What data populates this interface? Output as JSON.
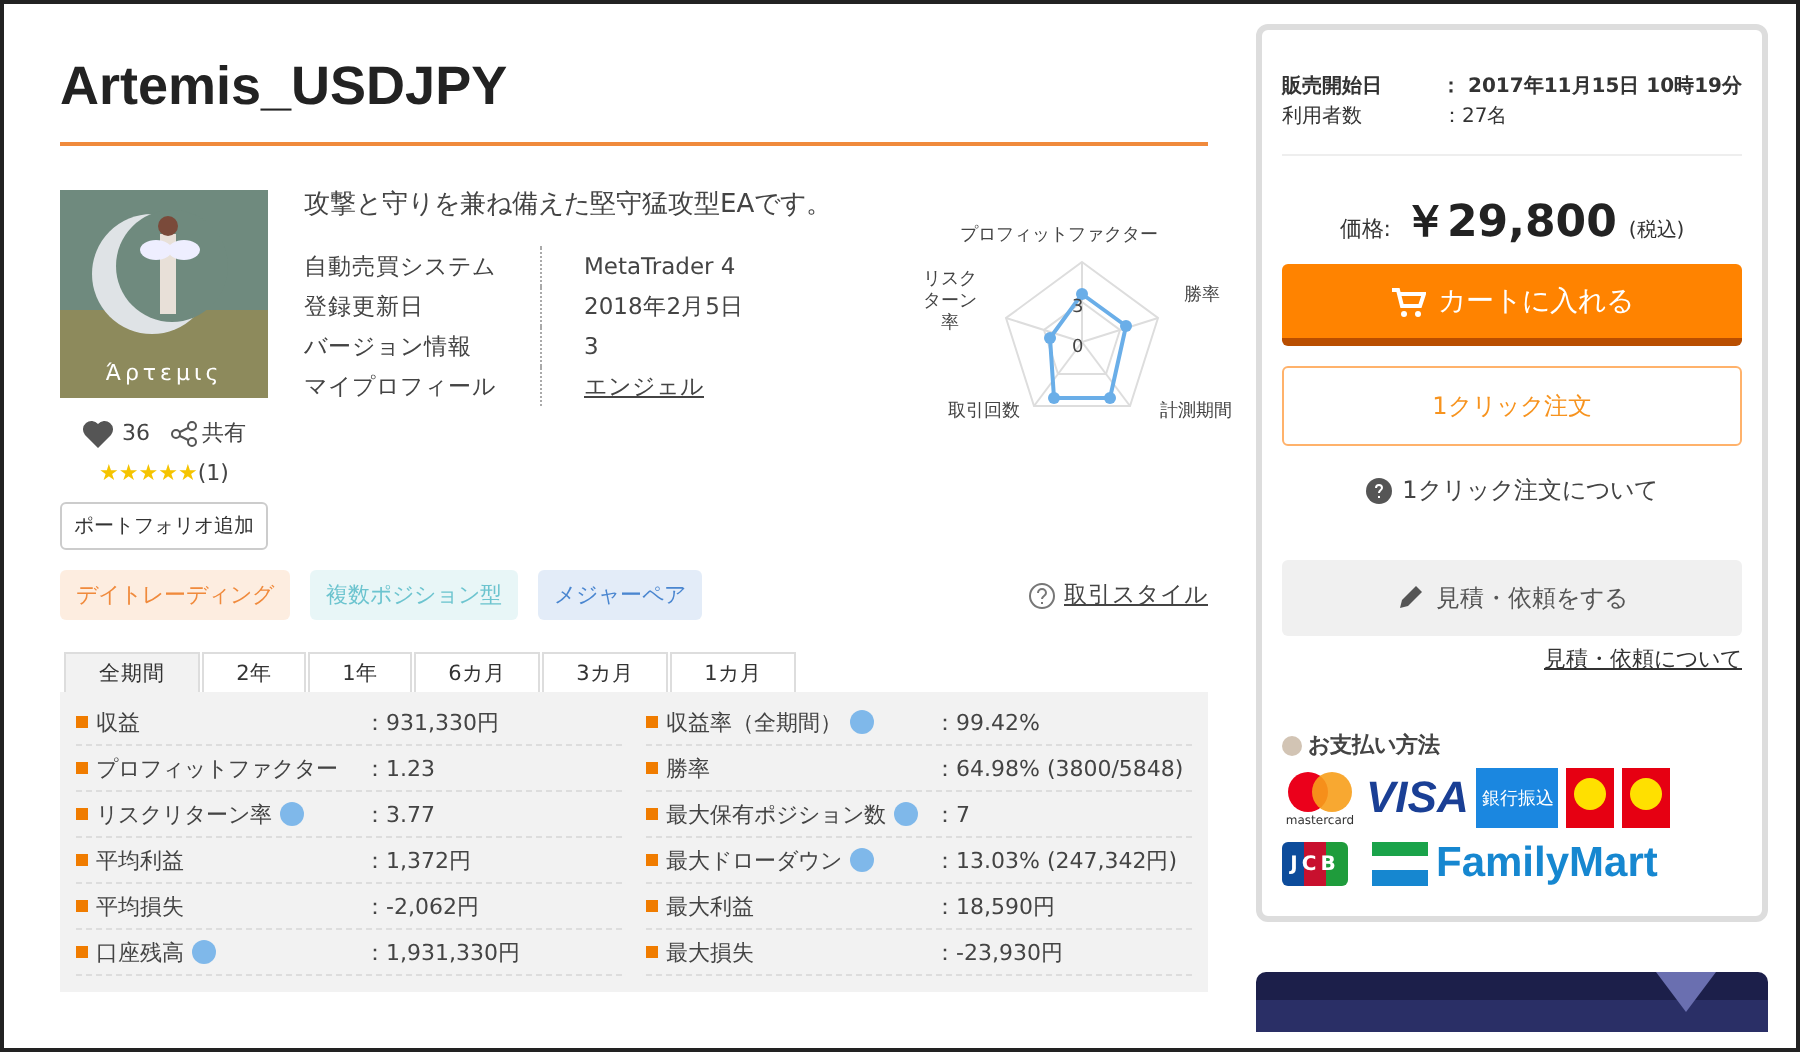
{
  "title": "Artemis_USDJPY",
  "product": {
    "image": {
      "caption": "Άρτεμις"
    },
    "description": "攻撃と守りを兼ね備えた堅守猛攻型EAです。",
    "likes": "36",
    "share": "共有",
    "stars": 5,
    "review_count": "(1)",
    "portfolio_button": "ポートフォリオ追加",
    "info": [
      {
        "label": "自動売買システム",
        "value": "MetaTrader 4",
        "link": false
      },
      {
        "label": "登録更新日",
        "value": "2018年2月5日",
        "link": false
      },
      {
        "label": "バージョン情報",
        "value": "3",
        "link": false
      },
      {
        "label": "マイプロフィール",
        "value": "エンジェル",
        "link": true
      }
    ]
  },
  "radar": {
    "axes": [
      "プロフィットファクター",
      "リスクターン率",
      "勝率",
      "取引回数",
      "計測期間"
    ],
    "tick_max": "3",
    "tick_min": "0"
  },
  "tags": [
    {
      "label": "デイトレーディング",
      "color": "#f08a3c"
    },
    {
      "label": "複数ポジション型",
      "color": "#6cc4cf"
    },
    {
      "label": "メジャーペア",
      "color": "#4a86d0"
    }
  ],
  "style_link": "取引スタイル",
  "tabs": [
    {
      "label": "全期間",
      "selected": true
    },
    {
      "label": "2年",
      "selected": false
    },
    {
      "label": "1年",
      "selected": false
    },
    {
      "label": "6カ月",
      "selected": false
    },
    {
      "label": "3カ月",
      "selected": false
    },
    {
      "label": "1カ月",
      "selected": false
    }
  ],
  "stats_left": [
    {
      "label": "収益",
      "value": "：931,330円",
      "help": false
    },
    {
      "label": "プロフィットファクター",
      "value": "：1.23",
      "help": false
    },
    {
      "label": "リスクリターン率",
      "value": "：3.77",
      "help": true
    },
    {
      "label": "平均利益",
      "value": "：1,372円",
      "help": false
    },
    {
      "label": "平均損失",
      "value": "：-2,062円",
      "help": false
    },
    {
      "label": "口座残高",
      "value": "：1,931,330円",
      "help": true
    }
  ],
  "stats_right": [
    {
      "label": "収益率（全期間）",
      "value": "：99.42%",
      "help": true
    },
    {
      "label": "勝率",
      "value": "：64.98% (3800/5848)",
      "help": false
    },
    {
      "label": "最大保有ポジション数",
      "value": "：7",
      "help": true
    },
    {
      "label": "最大ドローダウン",
      "value": "：13.03% (247,342円)",
      "help": true
    },
    {
      "label": "最大利益",
      "value": "：18,590円",
      "help": false
    },
    {
      "label": "最大損失",
      "value": "：-23,930円",
      "help": false
    }
  ],
  "sidebar": {
    "meta": [
      {
        "label": "販売開始日",
        "value": "： 2017年11月15日 10時19分",
        "bold": true
      },
      {
        "label": "利用者数",
        "value": "：27名",
        "bold": false
      }
    ],
    "price_label": "価格:",
    "price": "￥29,800",
    "tax": "(税込)",
    "cart_button": "カートに入れる",
    "one_click_button": "1クリック注文",
    "one_click_help": "1クリック注文について",
    "quote_button": "見積・依頼をする",
    "quote_link": "見積・依頼について",
    "payment_title": "お支払い方法",
    "payments": [
      {
        "kind": "mastercard",
        "label": "mastercard"
      },
      {
        "kind": "visa",
        "label": "VISA"
      },
      {
        "kind": "bank",
        "label": "銀行振込"
      },
      {
        "kind": "daily"
      },
      {
        "kind": "daily2"
      },
      {
        "kind": "jcb",
        "label": "JCB"
      },
      {
        "kind": "familymart",
        "label": "FamilyMart"
      }
    ]
  }
}
